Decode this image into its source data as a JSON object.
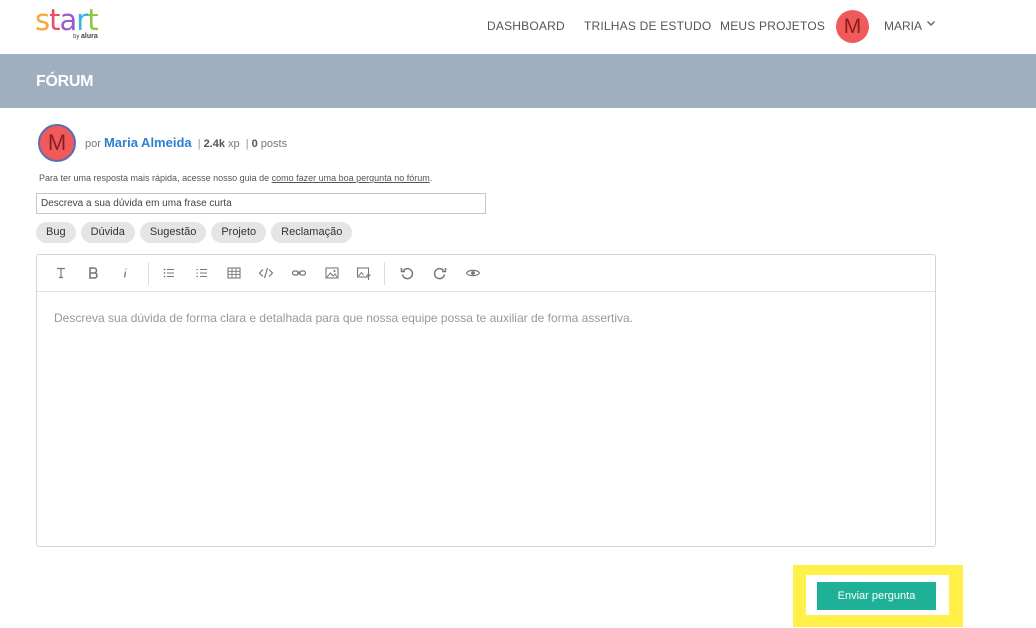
{
  "logo": {
    "letters": [
      {
        "ch": "s",
        "color": "#f9a53b"
      },
      {
        "ch": "t",
        "color": "#ee4b6a"
      },
      {
        "ch": "a",
        "color": "#9b59d0"
      },
      {
        "ch": "r",
        "color": "#2fb8e0"
      },
      {
        "ch": "t",
        "color": "#8dc63f"
      }
    ],
    "by": "by",
    "brand": "alura"
  },
  "nav": {
    "dashboard": "DASHBOARD",
    "trilhas": "TRILHAS DE ESTUDO",
    "projetos": "MEUS PROJETOS"
  },
  "user": {
    "initial": "M",
    "name": "MARIA",
    "avatar_color": "#f05a5b"
  },
  "page": {
    "title": "FÓRUM"
  },
  "author": {
    "initial": "M",
    "by": "por",
    "name": "Maria Almeida",
    "xp_value": "2.4k",
    "xp_unit": "xp",
    "posts_value": "0",
    "posts_unit": "posts"
  },
  "help": {
    "text": "Para ter uma resposta mais rápida, acesse nosso guia de ",
    "link": "como fazer uma boa pergunta no fórum",
    "end": "."
  },
  "form": {
    "title_placeholder": "Descreva a sua dúvida em uma frase curta",
    "tags": [
      "Bug",
      "Dúvida",
      "Sugestão",
      "Projeto",
      "Reclamação"
    ],
    "body_placeholder": "Descreva sua dúvida de forma clara e detalhada para que nossa equipe possa te auxiliar de forma assertiva.",
    "submit_label": "Enviar pergunta"
  },
  "colors": {
    "band": "#a0afc0",
    "accent_link": "#2c7fd1",
    "submit": "#1fb197",
    "highlight": "#fff04a"
  }
}
